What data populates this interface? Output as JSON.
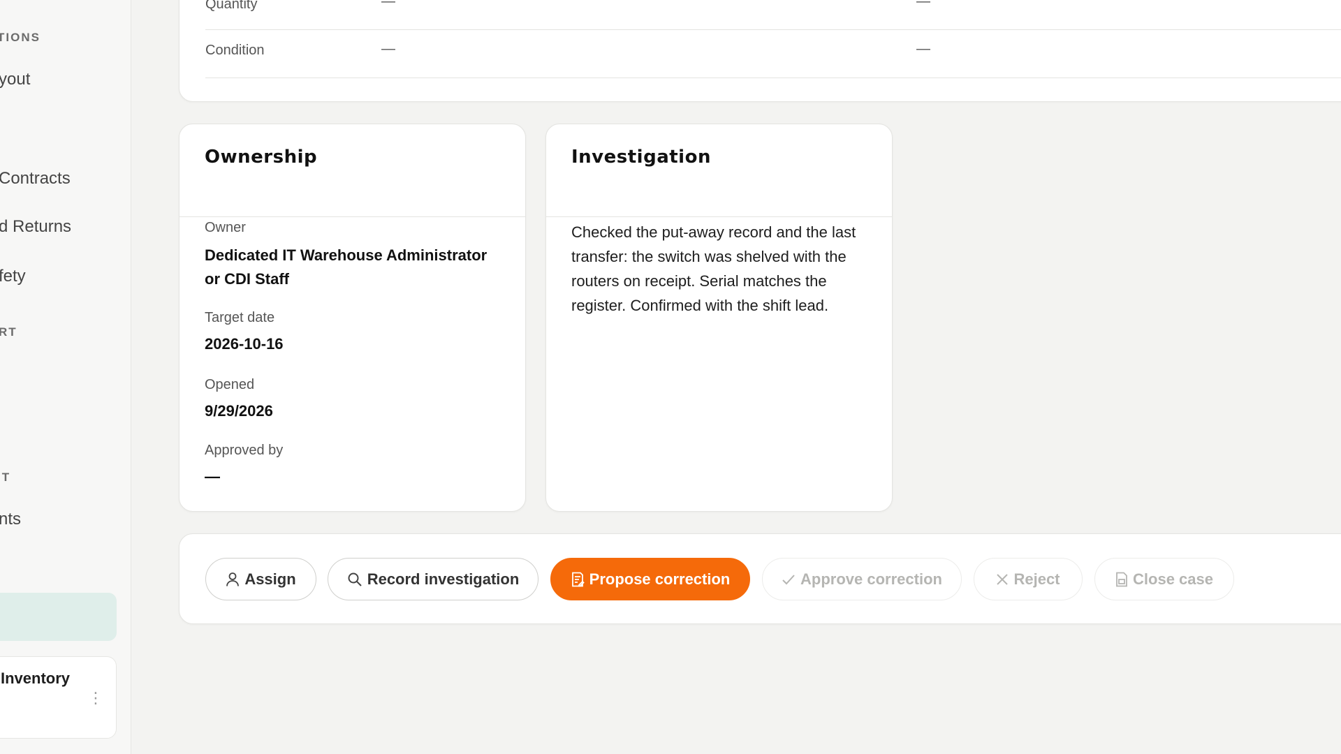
{
  "sidebar": {
    "sections": [
      "TIONS",
      "RT",
      "IT"
    ],
    "items": [
      "yout",
      "Contracts",
      "d Returns",
      "fety",
      "nts"
    ],
    "card_title": "Inventory",
    "card_menu": "⋮"
  },
  "details": {
    "rows": [
      {
        "label": "Quantity",
        "before": "—",
        "after": "—"
      },
      {
        "label": "Condition",
        "before": "—",
        "after": "—"
      }
    ]
  },
  "ownership": {
    "title": "Ownership",
    "owner_label": "Owner",
    "owner_value": "Dedicated IT Warehouse Administrator or CDI Staff",
    "target_label": "Target date",
    "target_value": "2026-10-16",
    "opened_label": "Opened",
    "opened_value": "9/29/2026",
    "approved_label": "Approved by",
    "approved_value": "—"
  },
  "investigation": {
    "title": "Investigation",
    "text": "Checked the put-away record and the last transfer: the switch was shelved with the routers on receipt. Serial matches the register. Confirmed with the shift lead."
  },
  "actions": {
    "assign": "Assign",
    "record": "Record investigation",
    "propose": "Propose correction",
    "approve": "Approve correction",
    "reject": "Reject",
    "close": "Close case"
  },
  "colors": {
    "accent": "#f56a0a",
    "active_nav": "#dfeeea"
  }
}
